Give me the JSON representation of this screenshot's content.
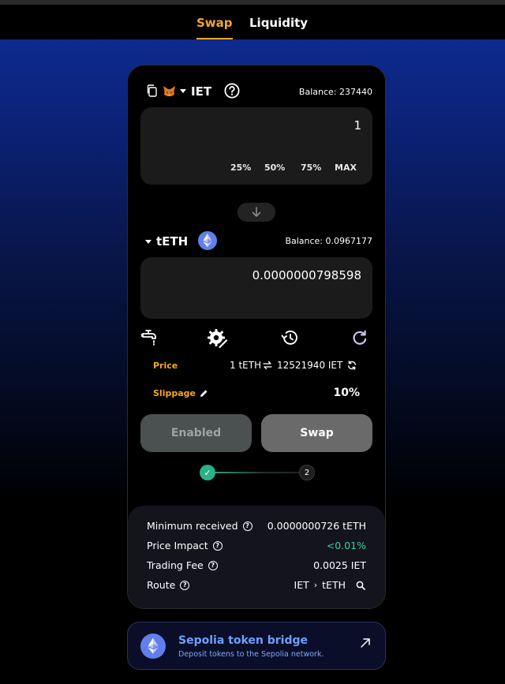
{
  "nav": {
    "tabs": [
      {
        "label": "Swap",
        "active": true
      },
      {
        "label": "Liquidity",
        "active": false
      }
    ]
  },
  "from": {
    "token": "IET",
    "balance": "Balance: 237440",
    "amount": "1",
    "percent_buttons": [
      "25%",
      "50%",
      "75%",
      "MAX"
    ]
  },
  "to": {
    "token": "tETH",
    "balance": "Balance: 0.0967177",
    "amount": "0.0000000798598"
  },
  "price": {
    "label": "Price",
    "value": "1 tETH",
    "value2": "12521940 IET"
  },
  "slippage": {
    "label": "Slippage",
    "value": "10%"
  },
  "buttons": {
    "enabled": "Enabled",
    "swap": "Swap"
  },
  "steps": {
    "step1": "✓",
    "step2": "2"
  },
  "details": {
    "min_received": {
      "label": "Minimum received",
      "value": "0.0000000726 tETH"
    },
    "price_impact": {
      "label": "Price Impact",
      "value": "<0.01%",
      "color": "#3ecf9e"
    },
    "trading_fee": {
      "label": "Trading Fee",
      "value": "0.0025 IET"
    },
    "route": {
      "label": "Route",
      "from": "IET",
      "sep": "›",
      "to": "tETH"
    }
  },
  "bridge": {
    "title": "Sepolia token bridge",
    "subtitle": "Deposit tokens to the Sepolia network."
  },
  "colors": {
    "accent": "#f6a623",
    "bridge_title": "#6fa0ff",
    "eth": "#627eea",
    "step_done": "#2bb08a"
  },
  "icons": [
    "copy-icon",
    "metamask-fox-icon",
    "caret-down-icon",
    "help-circle-icon",
    "arrow-down-icon",
    "ethereum-icon",
    "faucet-icon",
    "settings-icon",
    "history-icon",
    "refresh-icon",
    "swap-arrows-icon",
    "pencil-icon",
    "search-icon",
    "external-arrow-icon"
  ]
}
